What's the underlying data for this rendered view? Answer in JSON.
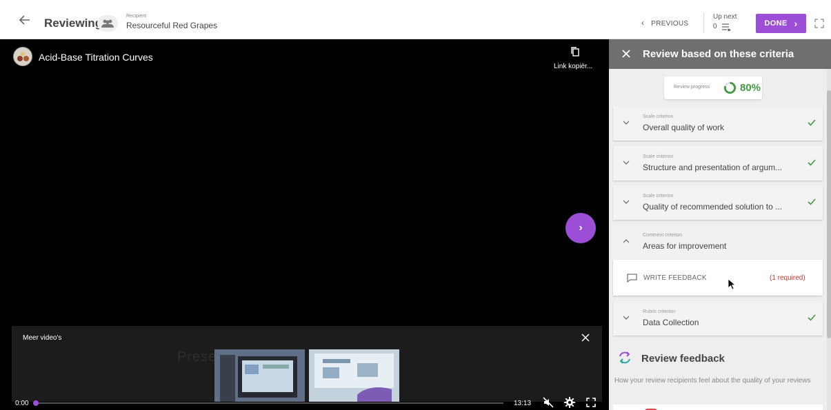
{
  "header": {
    "title": "Reviewing",
    "recipient_label": "Recipient",
    "recipient_name": "Resourceful Red Grapes",
    "previous_label": "PREVIOUS",
    "up_next_label": "Up next",
    "up_next_count": "0",
    "done_label": "DONE"
  },
  "video": {
    "title": "Acid-Base Titration Curves",
    "copy_link_label": "Link kopiër...",
    "more_videos_label": "Meer video's",
    "ghost_text": "Prese                                           rdino",
    "time_current": "0:00",
    "time_total": "13:13",
    "progress": 0
  },
  "panel": {
    "title": "Review based on these criteria",
    "progress_label": "Review progress",
    "progress_value": "80%",
    "progress_fraction": 0.8,
    "criteria": [
      {
        "type": "Scale criterion",
        "name": "Overall quality of work",
        "done": true
      },
      {
        "type": "Scale criterion",
        "name": "Structure and presentation of argum...",
        "done": true
      },
      {
        "type": "Scale criterion",
        "name": "Quality of recommended solution to ...",
        "done": true
      },
      {
        "type": "Comment criterion",
        "name": "Areas for improvement",
        "done": false,
        "expanded": true
      },
      {
        "type": "Rubric criterion",
        "name": "Data Collection",
        "done": true
      }
    ],
    "write_feedback_label": "WRITE FEEDBACK",
    "write_feedback_required": "(1 required)",
    "feedback_title": "Review feedback",
    "feedback_description": "How your review recipients feel about the quality of your reviews"
  },
  "colors": {
    "accent": "#9c4fd6",
    "check": "#3f9a42",
    "required": "#c0392b",
    "panel_header": "#6f6f6f"
  }
}
